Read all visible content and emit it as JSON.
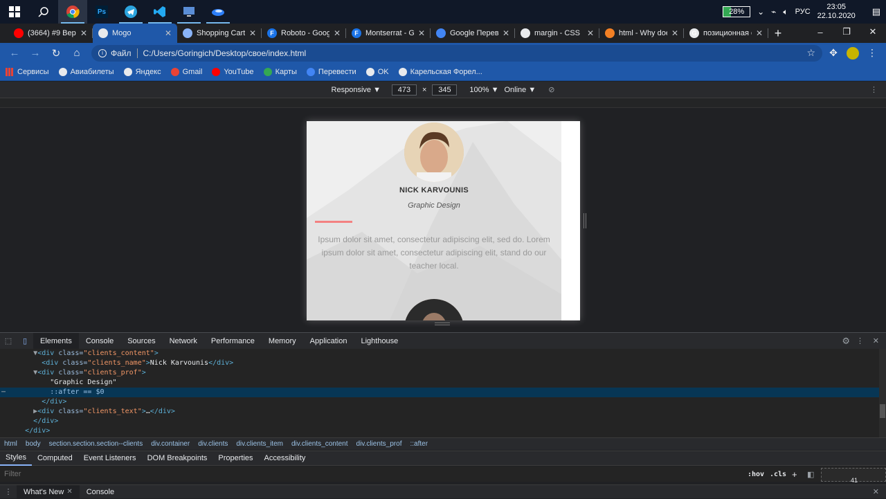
{
  "taskbar": {
    "battery": "28%",
    "battery_level": 0.28,
    "lang": "РУС",
    "time": "23:05",
    "date": "22.10.2020"
  },
  "tabs": [
    {
      "label": "(3664) #9 Верс",
      "icon": "youtube-icon",
      "color": "#ff0000"
    },
    {
      "label": "Mogo",
      "icon": "globe-icon",
      "color": "#e8eaed",
      "active": true
    },
    {
      "label": "Shopping Cart",
      "icon": "flag-icon",
      "color": "#8ab4f8"
    },
    {
      "label": "Roboto - Goog",
      "icon": "fonts-icon",
      "color": "#1a73e8",
      "glyph": "F"
    },
    {
      "label": "Montserrat - G",
      "icon": "fonts-icon",
      "color": "#1a73e8",
      "glyph": "F"
    },
    {
      "label": "Google Перево",
      "icon": "translate-icon",
      "color": "#4285f4"
    },
    {
      "label": "margin - CSS |",
      "icon": "mdn-icon",
      "color": "#e8eaed"
    },
    {
      "label": "html - Why doe",
      "icon": "stackoverflow-icon",
      "color": "#f48024"
    },
    {
      "label": "позиционная с",
      "icon": "google-icon",
      "color": "#e8eaed",
      "glyph": "G"
    }
  ],
  "omnibox": {
    "scheme": "Файл",
    "url": "C:/Users/Goringich/Desktop/свое/index.html"
  },
  "bookmarks": [
    {
      "label": "Сервисы",
      "icon": "apps-icon"
    },
    {
      "label": "Авиабилеты",
      "icon": "globe-icon"
    },
    {
      "label": "Яндекс",
      "icon": "globe-icon"
    },
    {
      "label": "Gmail",
      "icon": "gmail-icon"
    },
    {
      "label": "YouTube",
      "icon": "youtube-icon"
    },
    {
      "label": "Карты",
      "icon": "maps-icon"
    },
    {
      "label": "Перевести",
      "icon": "translate-icon"
    },
    {
      "label": "OK",
      "icon": "globe-icon"
    },
    {
      "label": "Карельская Форел...",
      "icon": "globe-icon"
    }
  ],
  "device_toolbar": {
    "mode": "Responsive ▼",
    "width": "473",
    "times": "×",
    "height": "345",
    "zoom": "100% ▼",
    "throttle": "Online ▼"
  },
  "page": {
    "client_name": "NICK KARVOUNIS",
    "client_prof": "Graphic Design",
    "client_text": "Ipsum dolor sit amet, consectetur adipiscing elit, sed do. Lorem ipsum dolor sit amet, consectetur adipiscing elit, stand do our teacher local."
  },
  "devtools": {
    "tabs": [
      "Elements",
      "Console",
      "Sources",
      "Network",
      "Performance",
      "Memory",
      "Application",
      "Lighthouse"
    ],
    "dom": [
      {
        "indent": "        ",
        "arrow": "▼",
        "open": "<div ",
        "attr": "class=",
        "val": "\"clients_content\"",
        "close": ">",
        "text": "",
        "end": ""
      },
      {
        "indent": "          ",
        "arrow": "",
        "open": "<div ",
        "attr": "class=",
        "val": "\"clients_name\"",
        "close": ">",
        "text": "Nick Karvounis",
        "end": "</div>"
      },
      {
        "indent": "        ",
        "arrow": "▼",
        "open": "<div ",
        "attr": "class=",
        "val": "\"clients_prof\"",
        "close": ">",
        "text": "",
        "end": ""
      },
      {
        "indent": "            ",
        "arrow": "",
        "open": "",
        "attr": "",
        "val": "",
        "close": "",
        "text": "\"Graphic Design\"",
        "end": ""
      },
      {
        "indent": "            ",
        "arrow": "",
        "open": "",
        "attr": "",
        "val": "",
        "close": "",
        "text": "::after == $0",
        "end": "",
        "selected": true
      },
      {
        "indent": "          ",
        "arrow": "",
        "open": "</div>",
        "attr": "",
        "val": "",
        "close": "",
        "text": "",
        "end": ""
      },
      {
        "indent": "        ",
        "arrow": "▶",
        "open": "<div ",
        "attr": "class=",
        "val": "\"clients_text\"",
        "close": ">",
        "text": "…",
        "end": "</div>"
      },
      {
        "indent": "        ",
        "arrow": "",
        "open": "</div>",
        "attr": "",
        "val": "",
        "close": "",
        "text": "",
        "end": ""
      },
      {
        "indent": "      ",
        "arrow": "",
        "open": "</div>",
        "attr": "",
        "val": "",
        "close": "",
        "text": "",
        "end": ""
      }
    ],
    "breadcrumbs": [
      "html",
      "body",
      "section.section.section--clients",
      "div.container",
      "div.clients",
      "div.clients_item",
      "div.clients_content",
      "div.clients_prof",
      "::after"
    ],
    "sub_tabs": [
      "Styles",
      "Computed",
      "Event Listeners",
      "DOM Breakpoints",
      "Properties",
      "Accessibility"
    ],
    "filter_placeholder": "Filter",
    "hov": ":hov",
    "cls": ".cls",
    "box_value": "41",
    "drawer_tabs": [
      "What's New",
      "Console"
    ]
  }
}
